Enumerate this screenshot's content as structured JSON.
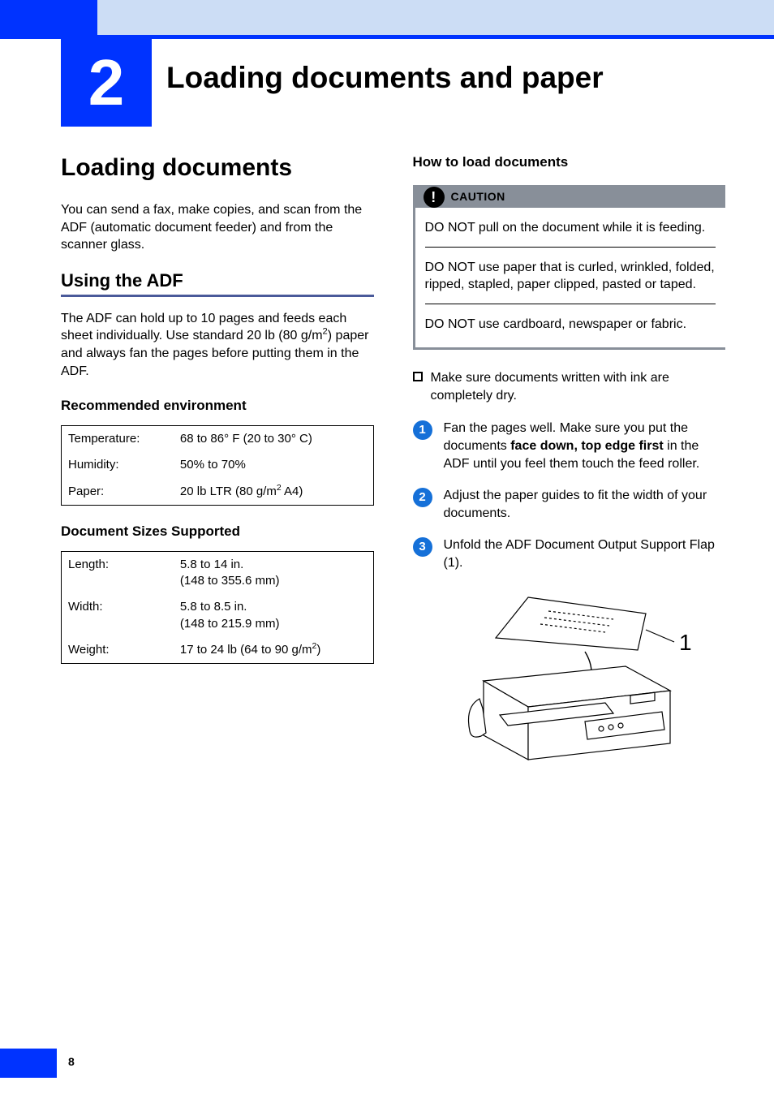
{
  "chapter": {
    "number": "2",
    "title": "Loading documents and paper"
  },
  "left": {
    "h1": "Loading documents",
    "intro": "You can send a fax, make copies, and scan from the ADF (automatic document feeder) and from the scanner glass.",
    "h2": "Using the ADF",
    "adf_para_pre": "The ADF can hold up to 10 pages and feeds each sheet individually. Use standard 20 lb (80 g/m",
    "adf_para_post": ") paper and always fan the pages before putting them in the ADF.",
    "env": {
      "heading": "Recommended environment",
      "rows": {
        "temperature": {
          "label": "Temperature:",
          "value": "68 to 86° F (20 to 30° C)"
        },
        "humidity": {
          "label": "Humidity:",
          "value": "50% to 70%"
        },
        "paper": {
          "label": "Paper:",
          "value_pre": "20 lb LTR (80 g/m",
          "value_post": "  A4)"
        }
      }
    },
    "sizes": {
      "heading": "Document Sizes Supported",
      "rows": {
        "length": {
          "label": "Length:",
          "value_l1": "5.8 to 14 in.",
          "value_l2": "(148 to 355.6 mm)"
        },
        "width": {
          "label": "Width:",
          "value_l1": "5.8 to 8.5 in.",
          "value_l2": "(148 to 215.9 mm)"
        },
        "weight": {
          "label": "Weight:",
          "value_pre": "17 to 24 lb (64 to 90 g/m",
          "value_post": ")"
        }
      }
    }
  },
  "right": {
    "heading": "How to load documents",
    "caution": {
      "label": "CAUTION",
      "items": {
        "a": "DO NOT pull on the document while it is feeding.",
        "b": "DO NOT use paper that is curled, wrinkled, folded, ripped, stapled, paper clipped, pasted or taped.",
        "c": "DO NOT use cardboard, newspaper or fabric."
      }
    },
    "bullet": "Make sure documents written with ink are completely dry.",
    "steps": {
      "s1_pre": "Fan the pages well. Make sure you put the documents ",
      "s1_bold": "face down, top edge first",
      "s1_post": " in the ADF until you feel them touch the feed roller.",
      "s2": "Adjust the paper guides to fit the width of your documents.",
      "s3": "Unfold the ADF Document Output Support Flap (1)."
    },
    "figure_label": "1"
  },
  "page_number": "8"
}
